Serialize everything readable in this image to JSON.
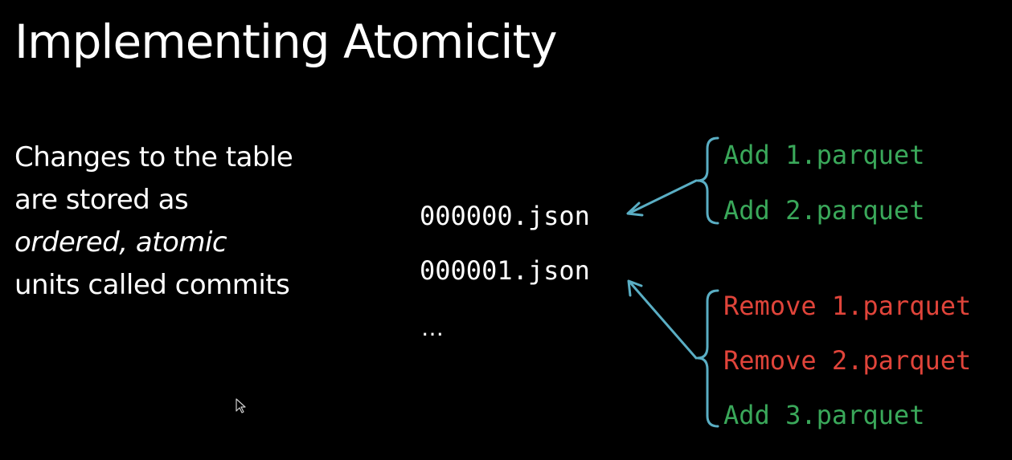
{
  "slide": {
    "title": "Implementing Atomicity",
    "description_lines": [
      {
        "text": "Changes to the table",
        "italic": false
      },
      {
        "text": "are stored as",
        "italic": false
      },
      {
        "text": "ordered, atomic",
        "italic": true
      },
      {
        "text": "units called commits",
        "italic": false
      }
    ],
    "files": [
      "000000.json",
      "000001.json"
    ],
    "ellipsis": "…",
    "commit_0_actions": [
      {
        "text": "Add 1.parquet",
        "kind": "add"
      },
      {
        "text": "Add 2.parquet",
        "kind": "add"
      }
    ],
    "commit_1_actions": [
      {
        "text": "Remove 1.parquet",
        "kind": "remove"
      },
      {
        "text": "Remove 2.parquet",
        "kind": "remove"
      },
      {
        "text": "Add 3.parquet",
        "kind": "add"
      }
    ]
  },
  "colors": {
    "background": "#000000",
    "text": "#ffffff",
    "add": "#3aa85a",
    "remove": "#e0443a",
    "arrow": "#5aaec4"
  },
  "icons": {
    "cursor": "mouse-pointer-icon"
  }
}
